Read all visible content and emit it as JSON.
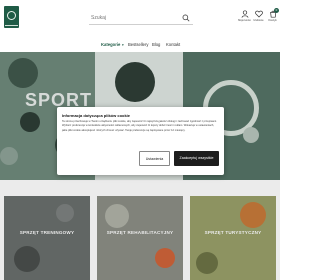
{
  "header": {
    "search": {
      "placeholder": "Szukaj"
    },
    "icons": [
      {
        "name": "user-icon",
        "label": "Moje konto"
      },
      {
        "name": "heart-icon",
        "label": "Ulubione"
      },
      {
        "name": "cart-icon",
        "label": "Koszyk",
        "count": "0"
      }
    ]
  },
  "nav": {
    "items": [
      "Kategorie",
      "Bestsellery",
      "Blog",
      "Kontakt"
    ]
  },
  "hero": {
    "title": "SPORT"
  },
  "cookie": {
    "title": "Informacja dotycząca plików cookie",
    "text": "Ta strona przechowuje w Twoim urządzeniu pliki cookie, aby zapewnić Ci najwyższą jakość obsługi i zachować zgodność z przepisami. Wybierz preferencje w kontekście aktywności reklamowych, aby zapewnić Ci lepszy dobór treści i reklam. Wskazuje w ustawieniach, jakie pliki cookie akceptujesz i których chcesz używać. Twoje preferencje są zapisywane przez 12 miesięcy.",
    "settings_label": "Ustawienia",
    "accept_label": "Zaakceptuj wszystkie"
  },
  "categories": [
    {
      "label": "SPRZĘT TRENINGOWY"
    },
    {
      "label": "SPRZĘT REHABILITACYJNY"
    },
    {
      "label": "SPRZĘT TURYSTYCZNY"
    }
  ],
  "colors": {
    "brand": "#1f5b46",
    "accept_button": "#1d1d1d"
  }
}
